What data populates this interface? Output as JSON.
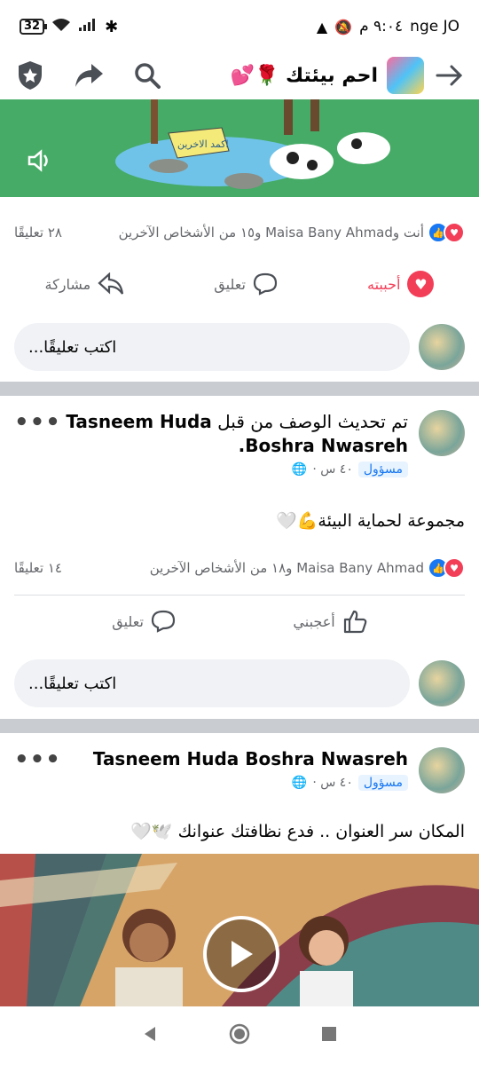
{
  "status_bar": {
    "battery": "32",
    "time": "٩:٠٤ م",
    "carrier": "nge JO"
  },
  "header": {
    "group_title": "احم بيئتك 🌹💕"
  },
  "post1": {
    "reactions_text": "أنت وMaisa Bany Ahmad و١٥ من الأشخاص الآخرين",
    "comments_count": "٢٨ تعليقًا",
    "like_label": "أحببته",
    "comment_label": "تعليق",
    "share_label": "مشاركة",
    "comment_placeholder": "اكتب تعليقًا..."
  },
  "post2": {
    "author": "Tasneem Huda",
    "description_update": "تم تحديث الوصف من قبل",
    "author_tail": "Boshra Nwasreh.",
    "role_badge": "مسؤول",
    "time": "٤٠ س ·",
    "text": "مجموعة لحماية البيئة💪🤍",
    "reactions_text": "Maisa Bany Ahmad و١٨ من الأشخاص الآخرين",
    "comments_count": "١٤ تعليقًا",
    "like_label": "أعجبني",
    "comment_label": "تعليق",
    "comment_placeholder": "اكتب تعليقًا..."
  },
  "post3": {
    "author": "Tasneem Huda Boshra Nwasreh",
    "role_badge": "مسؤول",
    "time": "٤٠ س ·",
    "text": "المكان سر العنوان .. فدع نظافتك عنوانك 🕊️🤍"
  },
  "banner": {
    "sign_text": "اكمد الاخرين"
  }
}
